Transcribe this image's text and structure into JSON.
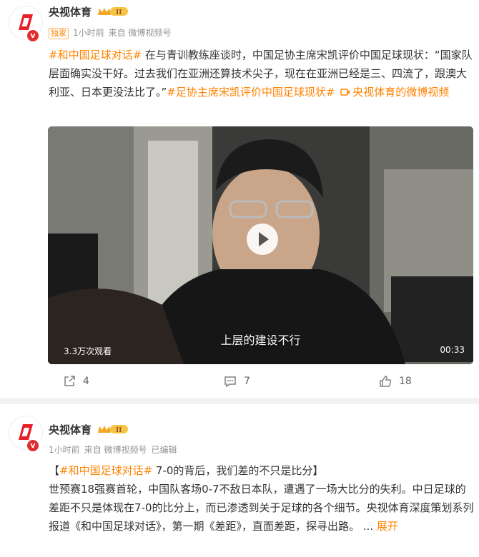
{
  "post1": {
    "author": "央视体育",
    "tag": "独家",
    "time": "1小时前",
    "source": "来自 微博视频号",
    "text_hashtag": "#和中国足球对话#",
    "text_body": " 在与青训教练座谈时，中国足协主席宋凯评价中国足球现状：“国家队层面确实没干好。过去我们在亚洲还算技术尖子，现在在亚洲已经是三、四流了，跟澳大利亚、日本更没法比了。”",
    "text_hashtag2": "#足协主席宋凯评价中国足球现状#",
    "text_video_link": "央视体育的微博视频",
    "video": {
      "subtitle": "上层的建设不行",
      "views": "3.3万次观看",
      "duration": "00:33"
    },
    "actions": {
      "share": "4",
      "comment": "7",
      "like": "18"
    }
  },
  "post2": {
    "author": "央视体育",
    "time": "1小时前",
    "source": "来自 微博视频号",
    "edited": "已编辑",
    "text_open": "【",
    "text_hashtag": "#和中国足球对话#",
    "text_title": " 7-0的背后，我们差的不只是比分】",
    "text_body": "世预赛18强赛首轮，中国队客场0-7不敌日本队，遭遇了一场大比分的失利。中日足球的差距不只是体现在7-0的比分上，而已渗透到关于足球的各个细节。央视体育深度策划系列报道《和中国足球对话》，第一期《差距》，直面差距，探寻出路。",
    "ellipsis": "  ...",
    "expand": "展开"
  },
  "colors": {
    "accent": "#ff8200",
    "verified": "#e02d2d",
    "logo": "#e8202a"
  }
}
